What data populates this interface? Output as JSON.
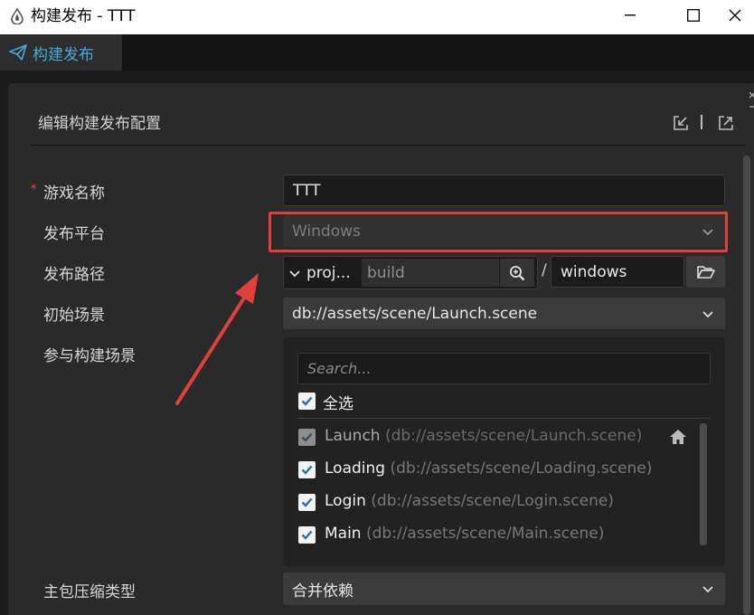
{
  "window": {
    "title": "构建发布 - TTT",
    "controls": {
      "minimize": "minimize-icon",
      "maximize": "maximize-icon",
      "close": "close-icon"
    }
  },
  "tab": {
    "label": "构建发布",
    "icon": "paper-plane-icon",
    "accent": "#4aa6da"
  },
  "panel": {
    "title": "编辑构建发布配置",
    "header_icons": [
      "import-icon",
      "export-icon"
    ]
  },
  "form": {
    "game_name": {
      "label": "游戏名称",
      "required_mark": "*",
      "value": "TTT"
    },
    "platform": {
      "label": "发布平台",
      "value": "Windows",
      "highlight_color": "#e0403c"
    },
    "build_path": {
      "label": "发布路径",
      "prefix": "proj...",
      "folder": "build",
      "separator": "/",
      "subfolder": "windows"
    },
    "start_scene": {
      "label": "初始场景",
      "value": "db://assets/scene/Launch.scene"
    },
    "scenes": {
      "label": "参与构建场景",
      "search_placeholder": "Search...",
      "select_all": "全选",
      "items": [
        {
          "name": "Launch",
          "path": "(db://assets/scene/Launch.scene)",
          "checked": true,
          "disabled": true
        },
        {
          "name": "Loading",
          "path": "(db://assets/scene/Loading.scene)",
          "checked": true,
          "disabled": false
        },
        {
          "name": "Login",
          "path": "(db://assets/scene/Login.scene)",
          "checked": true,
          "disabled": false
        },
        {
          "name": "Main",
          "path": "(db://assets/scene/Main.scene)",
          "checked": true,
          "disabled": false
        }
      ]
    },
    "compression": {
      "label": "主包压缩类型",
      "value": "合并依赖"
    }
  },
  "annotation": {
    "type": "arrow",
    "color": "#e0403c"
  }
}
